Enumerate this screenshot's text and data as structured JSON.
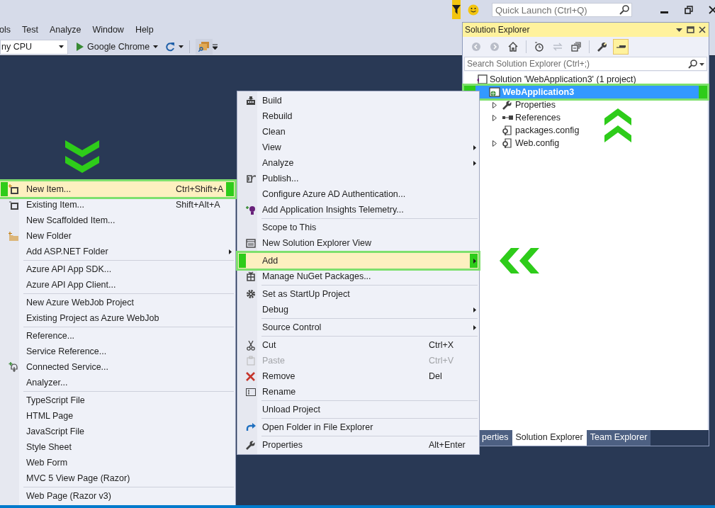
{
  "title_bar": {
    "quick_launch": {
      "placeholder": "Quick Launch (Ctrl+Q)"
    }
  },
  "menu_bar": [
    "ols",
    "Test",
    "Analyze",
    "Window",
    "Help"
  ],
  "toolbar": {
    "platform": "ny CPU",
    "run_target": "Google Chrome"
  },
  "solution_explorer": {
    "title": "Solution Explorer",
    "toolbar": [
      {
        "disabled": true,
        "active": false
      },
      {
        "disabled": true,
        "active": false
      },
      {
        "disabled": false,
        "active": false
      },
      {
        "disabled": false,
        "active": false
      },
      {
        "disabled": true,
        "active": false
      },
      {
        "disabled": false,
        "active": false
      },
      {
        "disabled": false,
        "active": false
      },
      {
        "disabled": false,
        "active": true
      }
    ],
    "search": {
      "placeholder": "Search Solution Explorer (Ctrl+;)"
    },
    "tree": [
      {
        "label": "Solution 'WebApplication3' (1 project)",
        "selected": false,
        "children": [
          {
            "label": "WebApplication3",
            "selected": true,
            "children": [
              {
                "label": "Properties",
                "selected": false,
                "expanded": false
              },
              {
                "label": "References",
                "selected": false,
                "expanded": false
              },
              {
                "label": "packages.config",
                "selected": false
              },
              {
                "label": "Web.config",
                "selected": false,
                "expanded": false
              }
            ]
          }
        ]
      }
    ],
    "tabs": [
      {
        "label": "perties",
        "selected": false
      },
      {
        "label": "Solution Explorer",
        "selected": true
      },
      {
        "label": "Team Explorer",
        "selected": false
      }
    ]
  },
  "project_menu": {
    "groups": [
      [
        {
          "label": "Build",
          "submenu": false,
          "selected": false,
          "disabled": false
        },
        {
          "label": "Rebuild",
          "submenu": false,
          "selected": false,
          "disabled": false
        },
        {
          "label": "Clean",
          "submenu": false,
          "selected": false,
          "disabled": false
        },
        {
          "label": "View",
          "submenu": true,
          "selected": false,
          "disabled": false
        },
        {
          "label": "Analyze",
          "submenu": true,
          "selected": false,
          "disabled": false
        },
        {
          "label": "Publish...",
          "submenu": false,
          "selected": false,
          "disabled": false
        },
        {
          "label": "Configure Azure AD Authentication...",
          "submenu": false,
          "selected": false,
          "disabled": false
        },
        {
          "label": "Add Application Insights Telemetry...",
          "submenu": false,
          "selected": false,
          "disabled": false
        }
      ],
      [
        {
          "label": "Scope to This",
          "submenu": false,
          "selected": false,
          "disabled": false
        },
        {
          "label": "New Solution Explorer View",
          "submenu": false,
          "selected": false,
          "disabled": false
        }
      ],
      [
        {
          "label": "Add",
          "submenu": true,
          "selected": true,
          "disabled": false
        },
        {
          "label": "Manage NuGet Packages...",
          "submenu": false,
          "selected": false,
          "disabled": false
        }
      ],
      [
        {
          "label": "Set as StartUp Project",
          "submenu": false,
          "selected": false,
          "disabled": false
        },
        {
          "label": "Debug",
          "submenu": true,
          "selected": false,
          "disabled": false
        }
      ],
      [
        {
          "label": "Source Control",
          "submenu": true,
          "selected": false,
          "disabled": false
        }
      ],
      [
        {
          "label": "Cut",
          "shortcut": "Ctrl+X",
          "submenu": false,
          "selected": false,
          "disabled": false
        },
        {
          "label": "Paste",
          "shortcut": "Ctrl+V",
          "submenu": false,
          "selected": false,
          "disabled": true
        },
        {
          "label": "Remove",
          "shortcut": "Del",
          "submenu": false,
          "selected": false,
          "disabled": false
        },
        {
          "label": "Rename",
          "submenu": false,
          "selected": false,
          "disabled": false
        }
      ],
      [
        {
          "label": "Unload Project",
          "submenu": false,
          "selected": false,
          "disabled": false
        }
      ],
      [
        {
          "label": "Open Folder in File Explorer",
          "submenu": false,
          "selected": false,
          "disabled": false
        }
      ],
      [
        {
          "label": "Properties",
          "shortcut": "Alt+Enter",
          "submenu": false,
          "selected": false,
          "disabled": false
        }
      ]
    ]
  },
  "add_menu": {
    "groups": [
      [
        {
          "label": "New Item...",
          "shortcut": "Ctrl+Shift+A",
          "submenu": false,
          "selected": true,
          "disabled": false
        },
        {
          "label": "Existing Item...",
          "shortcut": "Shift+Alt+A",
          "submenu": false,
          "selected": false,
          "disabled": false
        },
        {
          "label": "New Scaffolded Item...",
          "submenu": false,
          "selected": false,
          "disabled": false
        },
        {
          "label": "New Folder",
          "submenu": false,
          "selected": false,
          "disabled": false
        },
        {
          "label": "Add ASP.NET Folder",
          "submenu": true,
          "selected": false,
          "disabled": false
        }
      ],
      [
        {
          "label": "Azure API App SDK...",
          "submenu": false,
          "selected": false,
          "disabled": false
        },
        {
          "label": "Azure API App Client...",
          "submenu": false,
          "selected": false,
          "disabled": false
        }
      ],
      [
        {
          "label": "New Azure WebJob Project",
          "submenu": false,
          "selected": false,
          "disabled": false
        },
        {
          "label": "Existing Project as Azure WebJob",
          "submenu": false,
          "selected": false,
          "disabled": false
        }
      ],
      [
        {
          "label": "Reference...",
          "submenu": false,
          "selected": false,
          "disabled": false
        },
        {
          "label": "Service Reference...",
          "submenu": false,
          "selected": false,
          "disabled": false
        },
        {
          "label": "Connected Service...",
          "submenu": false,
          "selected": false,
          "disabled": false
        },
        {
          "label": "Analyzer...",
          "submenu": false,
          "selected": false,
          "disabled": false
        }
      ],
      [
        {
          "label": "TypeScript File",
          "submenu": false,
          "selected": false,
          "disabled": false
        },
        {
          "label": "HTML Page",
          "submenu": false,
          "selected": false,
          "disabled": false
        },
        {
          "label": "JavaScript File",
          "submenu": false,
          "selected": false,
          "disabled": false
        },
        {
          "label": "Style Sheet",
          "submenu": false,
          "selected": false,
          "disabled": false
        },
        {
          "label": "Web Form",
          "submenu": false,
          "selected": false,
          "disabled": false
        },
        {
          "label": "MVC 5 View Page (Razor)",
          "submenu": false,
          "selected": false,
          "disabled": false
        }
      ],
      [
        {
          "label": "Web Page (Razor v3)",
          "submenu": false,
          "selected": false,
          "disabled": false
        }
      ]
    ]
  }
}
